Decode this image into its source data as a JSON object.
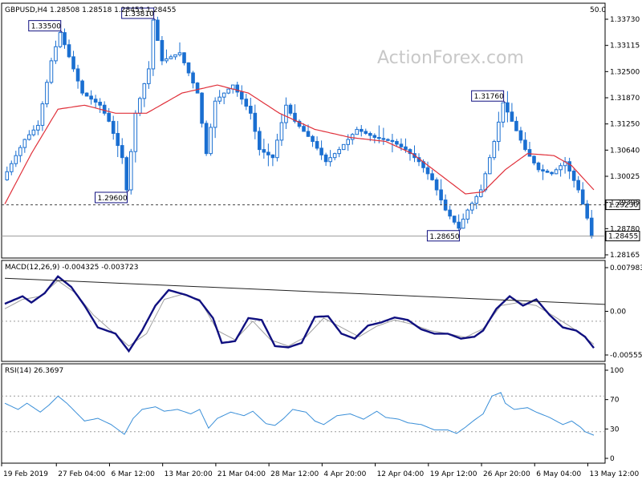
{
  "header": {
    "symbol_line": "GBPUSD,H4  1.28508 1.28518 1.28453 1.28455",
    "ma_period_label": "50.0"
  },
  "watermark": "ActionForex.com",
  "macd_label": "MACD(12,26,9) -0.004325 -0.003723",
  "rsi_label": "RSI(14) 26.3697",
  "colors": {
    "candles": "#1a6fd1",
    "ma": "#e0303a",
    "macd": "#101080",
    "signal": "#a0a0a0",
    "rsi": "#3a8fd8",
    "axis": "#000000",
    "dotted": "#9a9a9a",
    "box_border": "#101080"
  },
  "chart_data": [
    {
      "type": "candlestick",
      "title": "GBPUSD,H4",
      "ohlc_last": {
        "open": 1.28508,
        "high": 1.28518,
        "low": 1.28453,
        "close": 1.28455
      },
      "yticks": [
        "1.33730",
        "1.33115",
        "1.32500",
        "1.31870",
        "1.31250",
        "1.30640",
        "1.30025",
        "1.29395",
        "1.28780",
        "1.28165"
      ],
      "ylim": [
        1.2795,
        1.3395
      ],
      "price_path": [
        [
          0,
          1.2985
        ],
        [
          5,
          1.3085
        ],
        [
          8,
          1.312
        ],
        [
          11,
          1.328
        ],
        [
          13,
          1.335
        ],
        [
          16,
          1.326
        ],
        [
          18,
          1.32
        ],
        [
          22,
          1.317
        ],
        [
          24,
          1.313
        ],
        [
          27,
          1.304
        ],
        [
          28,
          1.296
        ],
        [
          30,
          1.315
        ],
        [
          33,
          1.326
        ],
        [
          34,
          1.3381
        ],
        [
          36,
          1.328
        ],
        [
          40,
          1.33
        ],
        [
          44,
          1.32
        ],
        [
          46,
          1.305
        ],
        [
          48,
          1.318
        ],
        [
          52,
          1.322
        ],
        [
          56,
          1.315
        ],
        [
          58,
          1.306
        ],
        [
          61,
          1.304
        ],
        [
          64,
          1.317
        ],
        [
          66,
          1.313
        ],
        [
          70,
          1.308
        ],
        [
          73,
          1.303
        ],
        [
          76,
          1.306
        ],
        [
          80,
          1.311
        ],
        [
          84,
          1.309
        ],
        [
          88,
          1.308
        ],
        [
          91,
          1.306
        ],
        [
          94,
          1.303
        ],
        [
          97,
          1.2985
        ],
        [
          100,
          1.291
        ],
        [
          103,
          1.2865
        ],
        [
          105,
          1.291
        ],
        [
          108,
          1.296
        ],
        [
          111,
          1.308
        ],
        [
          113,
          1.3176
        ],
        [
          115,
          1.313
        ],
        [
          118,
          1.306
        ],
        [
          121,
          1.301
        ],
        [
          124,
          1.3
        ],
        [
          127,
          1.303
        ],
        [
          130,
          1.296
        ],
        [
          132,
          1.289
        ],
        [
          133,
          1.2845
        ]
      ],
      "ma": {
        "label": "",
        "path": [
          [
            0,
            1.2925
          ],
          [
            6,
            1.305
          ],
          [
            12,
            1.316
          ],
          [
            18,
            1.317
          ],
          [
            25,
            1.315
          ],
          [
            32,
            1.315
          ],
          [
            40,
            1.32
          ],
          [
            48,
            1.322
          ],
          [
            55,
            1.32
          ],
          [
            62,
            1.315
          ],
          [
            70,
            1.311
          ],
          [
            78,
            1.309
          ],
          [
            86,
            1.308
          ],
          [
            92,
            1.305
          ],
          [
            98,
            1.3
          ],
          [
            104,
            1.295
          ],
          [
            108,
            1.2955
          ],
          [
            113,
            1.301
          ],
          [
            118,
            1.305
          ],
          [
            124,
            1.3045
          ],
          [
            128,
            1.302
          ],
          [
            133,
            1.296
          ]
        ]
      },
      "annotations": [
        {
          "text": "1.33500",
          "value": 1.335
        },
        {
          "text": "1.33810",
          "value": 1.3381
        },
        {
          "text": "1.29600",
          "value": 1.296
        },
        {
          "text": "1.31760",
          "value": 1.3176
        },
        {
          "text": "1.28650",
          "value": 1.2865
        }
      ],
      "hlines": [
        {
          "value": 1.2923,
          "label": "1.29230",
          "style": "dotted"
        },
        {
          "value": 1.28455,
          "label": "1.28455",
          "style": "solid"
        }
      ]
    },
    {
      "type": "line",
      "title": "MACD(12,26,9) -0.004325 -0.003723",
      "yticks": [
        "0.007983",
        "0.00",
        "-0.005559"
      ],
      "ylim": [
        -0.0062,
        0.0086
      ],
      "series": [
        {
          "name": "",
          "path": [
            [
              0,
              0.0028
            ],
            [
              4,
              0.004
            ],
            [
              6,
              0.003
            ],
            [
              9,
              0.0045
            ],
            [
              12,
              0.0072
            ],
            [
              15,
              0.0055
            ],
            [
              18,
              0.0025
            ],
            [
              21,
              -0.001
            ],
            [
              25,
              -0.002
            ],
            [
              28,
              -0.0048
            ],
            [
              31,
              -0.0015
            ],
            [
              34,
              0.0025
            ],
            [
              37,
              0.005
            ],
            [
              41,
              0.0042
            ],
            [
              44,
              0.0033
            ],
            [
              47,
              0.0005
            ],
            [
              49,
              -0.0035
            ],
            [
              52,
              -0.0032
            ],
            [
              55,
              0.0005
            ],
            [
              58,
              0.0002
            ],
            [
              61,
              -0.004
            ],
            [
              64,
              -0.0042
            ],
            [
              67,
              -0.0035
            ],
            [
              70,
              0.0007
            ],
            [
              73,
              0.0008
            ],
            [
              76,
              -0.002
            ],
            [
              79,
              -0.0028
            ],
            [
              82,
              -0.0007
            ],
            [
              85,
              -0.0002
            ],
            [
              88,
              0.0006
            ],
            [
              91,
              0.0002
            ],
            [
              94,
              -0.0013
            ],
            [
              97,
              -0.002
            ],
            [
              100,
              -0.002
            ],
            [
              103,
              -0.0028
            ],
            [
              106,
              -0.0025
            ],
            [
              108,
              -0.0015
            ],
            [
              111,
              0.002
            ],
            [
              114,
              0.004
            ],
            [
              117,
              0.0025
            ],
            [
              120,
              0.0035
            ],
            [
              123,
              0.001
            ],
            [
              126,
              -0.001
            ],
            [
              129,
              -0.0015
            ],
            [
              131,
              -0.0025
            ],
            [
              133,
              -0.0043
            ]
          ]
        },
        {
          "name": "",
          "path": [
            [
              0,
              0.002
            ],
            [
              4,
              0.0035
            ],
            [
              8,
              0.004
            ],
            [
              12,
              0.0065
            ],
            [
              16,
              0.0045
            ],
            [
              20,
              0.001
            ],
            [
              24,
              -0.0015
            ],
            [
              28,
              -0.004
            ],
            [
              32,
              -0.002
            ],
            [
              36,
              0.0035
            ],
            [
              40,
              0.0043
            ],
            [
              44,
              0.0035
            ],
            [
              48,
              -0.0015
            ],
            [
              52,
              -0.003
            ],
            [
              56,
              0.0
            ],
            [
              60,
              -0.003
            ],
            [
              64,
              -0.004
            ],
            [
              68,
              -0.0025
            ],
            [
              72,
              0.0005
            ],
            [
              76,
              -0.001
            ],
            [
              80,
              -0.0025
            ],
            [
              84,
              -0.0008
            ],
            [
              88,
              0.0002
            ],
            [
              92,
              -0.0005
            ],
            [
              96,
              -0.0015
            ],
            [
              100,
              -0.002
            ],
            [
              104,
              -0.0026
            ],
            [
              108,
              -0.0012
            ],
            [
              112,
              0.0025
            ],
            [
              116,
              0.003
            ],
            [
              120,
              0.0025
            ],
            [
              124,
              0.0008
            ],
            [
              128,
              -0.001
            ],
            [
              133,
              -0.0037
            ]
          ]
        }
      ],
      "trendline": [
        [
          0,
          0.0069
        ],
        [
          133,
          0.0027
        ]
      ]
    },
    {
      "type": "line",
      "title": "RSI(14) 26.3697",
      "yticks": [
        "100",
        "70",
        "30",
        "0"
      ],
      "ylim": [
        0,
        100
      ],
      "levels": [
        70,
        30
      ],
      "series": [
        {
          "name": "",
          "path": [
            [
              0,
              62
            ],
            [
              3,
              55
            ],
            [
              5,
              62
            ],
            [
              8,
              52
            ],
            [
              10,
              60
            ],
            [
              12,
              70
            ],
            [
              14,
              62
            ],
            [
              16,
              52
            ],
            [
              18,
              42
            ],
            [
              21,
              45
            ],
            [
              24,
              38
            ],
            [
              27,
              27
            ],
            [
              29,
              45
            ],
            [
              31,
              55
            ],
            [
              34,
              58
            ],
            [
              36,
              53
            ],
            [
              39,
              55
            ],
            [
              42,
              50
            ],
            [
              44,
              55
            ],
            [
              46,
              34
            ],
            [
              48,
              45
            ],
            [
              51,
              52
            ],
            [
              54,
              48
            ],
            [
              56,
              53
            ],
            [
              59,
              39
            ],
            [
              61,
              37
            ],
            [
              63,
              45
            ],
            [
              65,
              55
            ],
            [
              68,
              52
            ],
            [
              70,
              42
            ],
            [
              72,
              38
            ],
            [
              75,
              48
            ],
            [
              78,
              50
            ],
            [
              81,
              44
            ],
            [
              84,
              53
            ],
            [
              86,
              46
            ],
            [
              89,
              44
            ],
            [
              91,
              40
            ],
            [
              94,
              38
            ],
            [
              97,
              32
            ],
            [
              100,
              32
            ],
            [
              102,
              28
            ],
            [
              104,
              35
            ],
            [
              106,
              43
            ],
            [
              108,
              50
            ],
            [
              110,
              70
            ],
            [
              112,
              74
            ],
            [
              113,
              62
            ],
            [
              115,
              55
            ],
            [
              118,
              57
            ],
            [
              120,
              52
            ],
            [
              123,
              46
            ],
            [
              126,
              38
            ],
            [
              128,
              42
            ],
            [
              130,
              35
            ],
            [
              131,
              30
            ],
            [
              133,
              26
            ]
          ]
        }
      ]
    }
  ],
  "x_axis": {
    "labels": [
      "19 Feb 2019",
      "27 Feb 04:00",
      "6 Mar 12:00",
      "13 Mar 20:00",
      "21 Mar 04:00",
      "28 Mar 12:00",
      "4 Apr 20:00",
      "12 Apr 04:00",
      "19 Apr 12:00",
      "26 Apr 20:00",
      "6 May 04:00",
      "13 May 12:00"
    ],
    "bars_between_labels": 12
  }
}
